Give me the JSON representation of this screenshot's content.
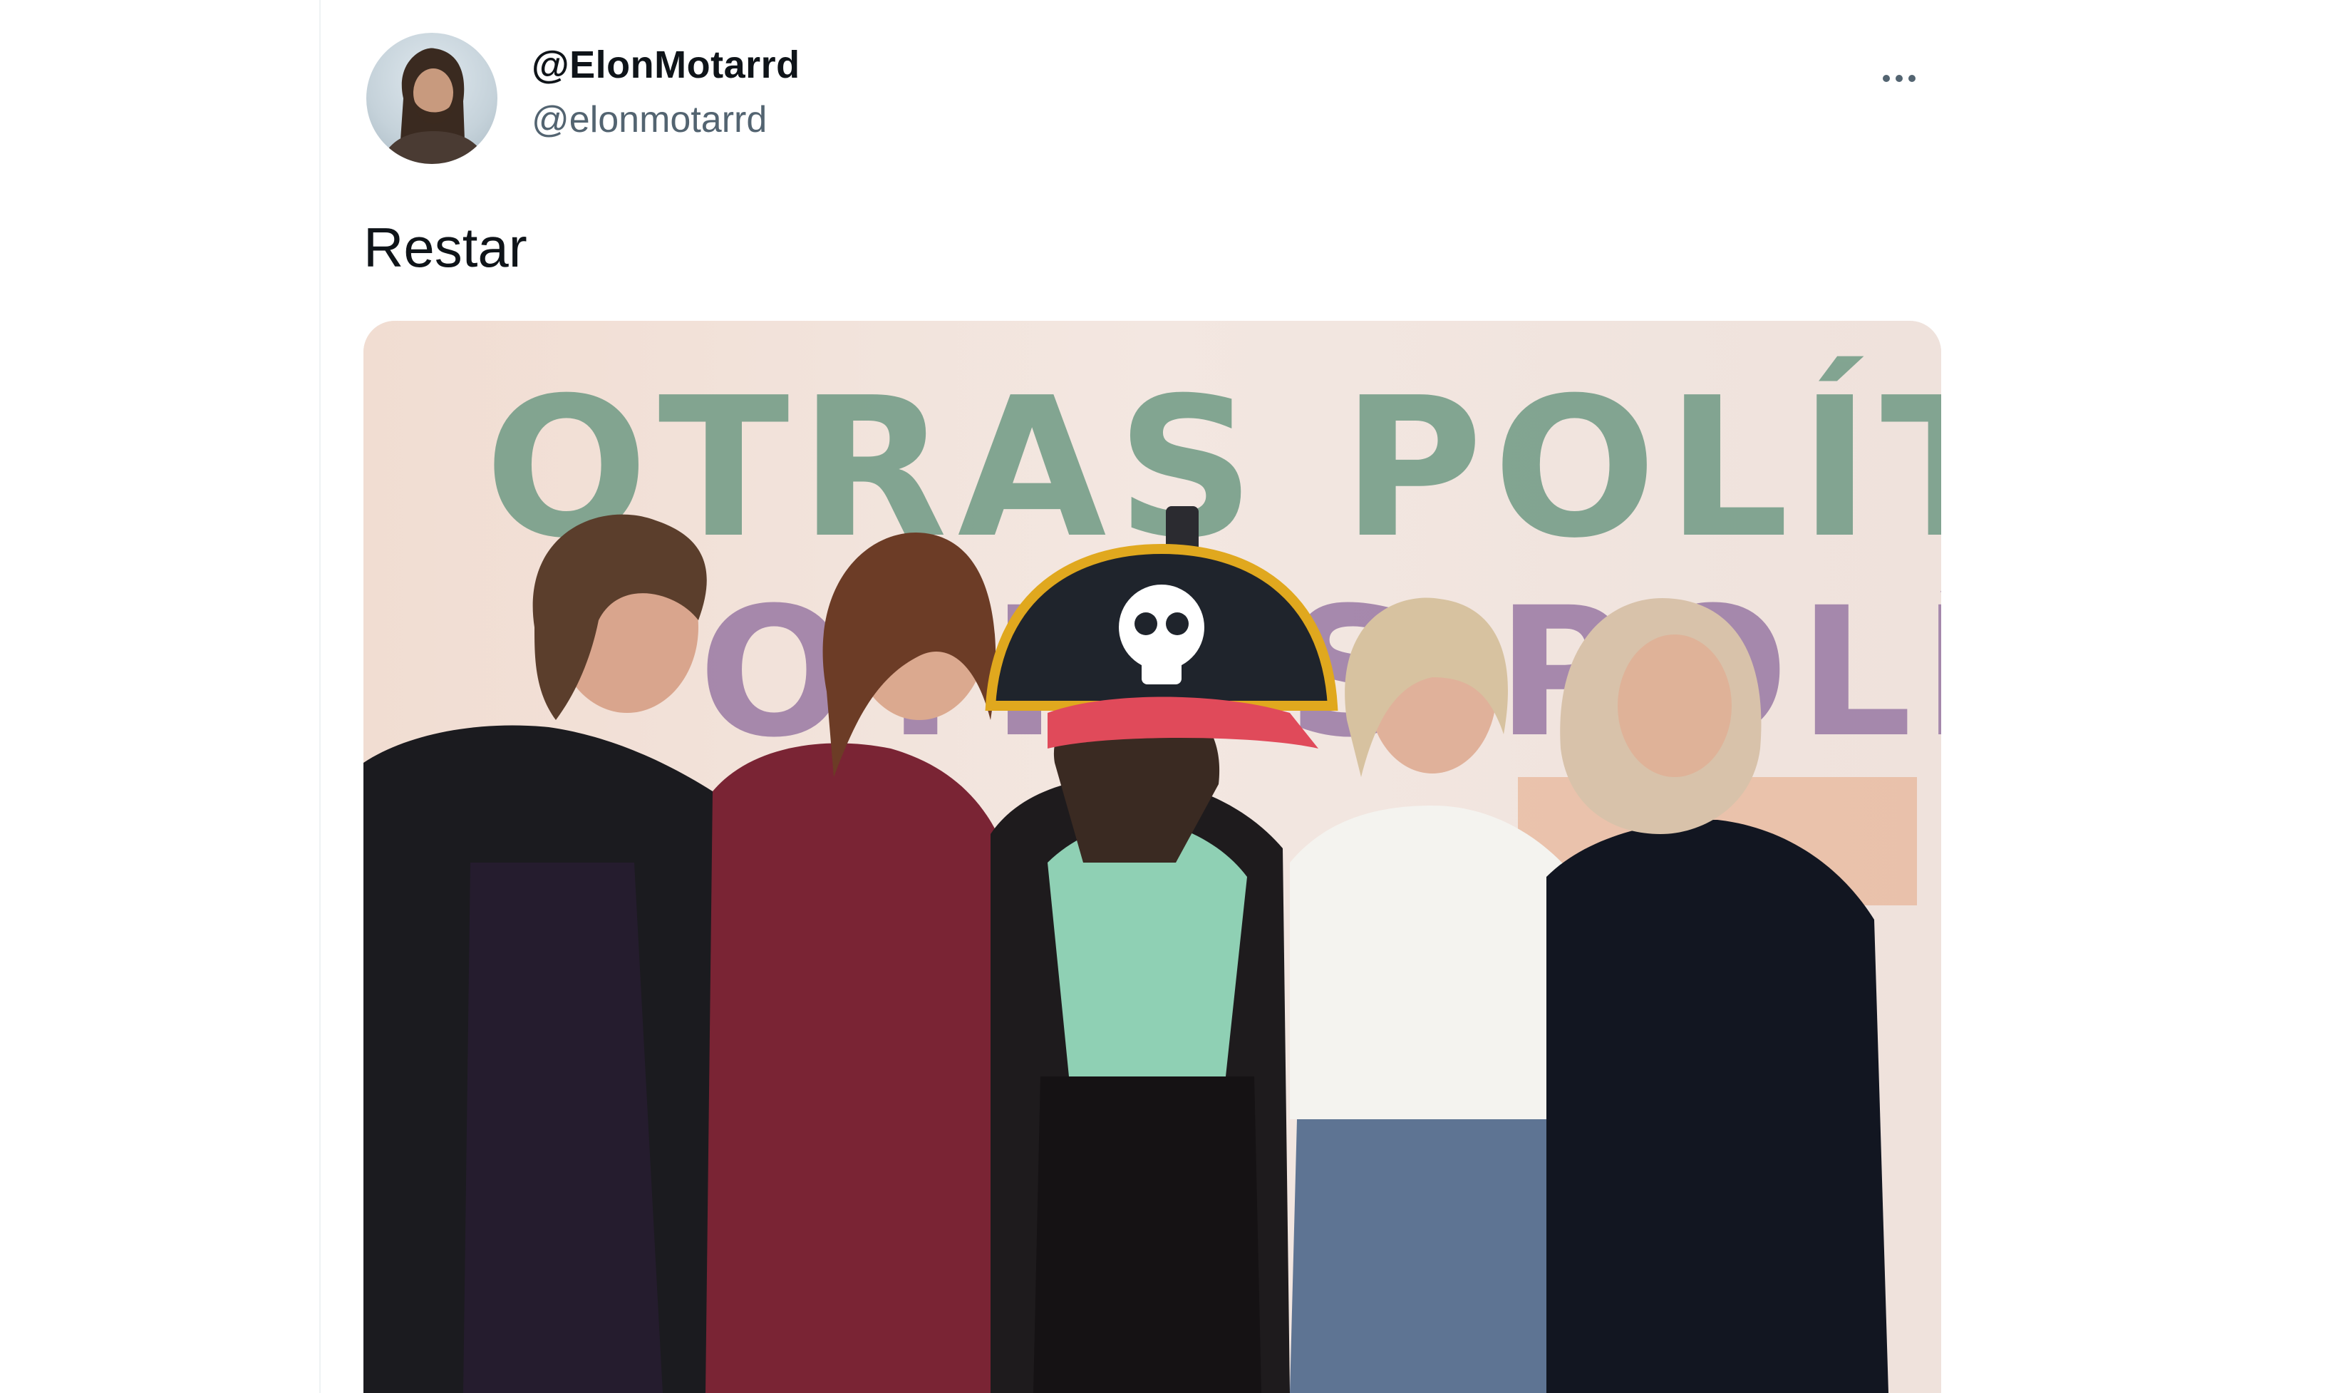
{
  "tweet": {
    "display_name": "@ElonMotarrd",
    "handle": "@elonmotarrd",
    "text": "Restar",
    "more_icon": "more-horizontal-icon"
  },
  "media": {
    "banner_line_1": "OTRAS POLÍTICAS",
    "banner_line_2": "OTRAS POLÍTICAS",
    "colors": {
      "banner_green": "#6f9a84",
      "banner_purple": "#8d6a9c",
      "banner_orange": "#e39a6e",
      "backdrop": "#efe3dc"
    }
  },
  "colors": {
    "text_primary": "#0f1419",
    "text_secondary": "#536471",
    "divider": "#eff3f4"
  }
}
